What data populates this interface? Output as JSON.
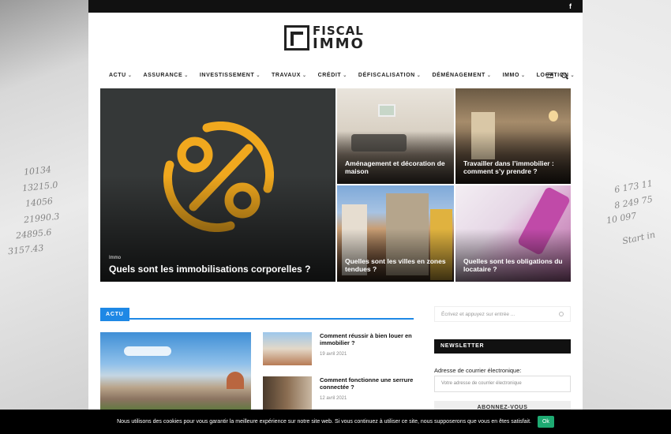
{
  "topbar": {
    "social_icon": "f"
  },
  "logo": {
    "line1": "FISCAL",
    "line2": "IMMO"
  },
  "nav": {
    "items": [
      {
        "label": "ACTU"
      },
      {
        "label": "ASSURANCE"
      },
      {
        "label": "INVESTISSEMENT"
      },
      {
        "label": "TRAVAUX"
      },
      {
        "label": "CRÉDIT"
      },
      {
        "label": "DÉFISCALISATION"
      },
      {
        "label": "DÉMÉNAGEMENT"
      },
      {
        "label": "IMMO"
      },
      {
        "label": "LOCATION"
      }
    ]
  },
  "hero": {
    "main": {
      "category": "Immo",
      "title": "Quels sont les immobilisations corporelles ?"
    },
    "tiles": [
      {
        "title": "Aménagement et décoration de maison"
      },
      {
        "title": "Travailler dans l’immobilier : comment s’y prendre ?"
      },
      {
        "title": "Quelles sont les villes en zones tendues ?"
      },
      {
        "title": "Quelles sont les obligations du locataire ?"
      }
    ]
  },
  "actu": {
    "section_label": "ACTU",
    "side_posts": [
      {
        "title": "Comment réussir à bien louer en immobilier ?",
        "date": "19 avril 2021"
      },
      {
        "title": "Comment fonctionne une serrure connectée ?",
        "date": "12 avril 2021"
      }
    ]
  },
  "sidebar": {
    "search_placeholder": "Écrivez et appuyez sur entrée ...",
    "newsletter_title": "NEWSLETTER",
    "email_label": "Adresse de courrier électronique:",
    "email_placeholder": "Votre adresse de courrier électronique",
    "subscribe_label": "ABONNEZ-VOUS"
  },
  "cookie": {
    "message": "Nous utilisons des cookies pour vous garantir la meilleure expérience sur notre site web. Si vous continuez à utiliser ce site, nous supposerons que vous en êtes satisfait.",
    "ok_label": "Ok"
  },
  "colors": {
    "accent": "#1e88e5",
    "percent_icon": "#f0a81e",
    "cookie_button": "#1eaa72"
  }
}
